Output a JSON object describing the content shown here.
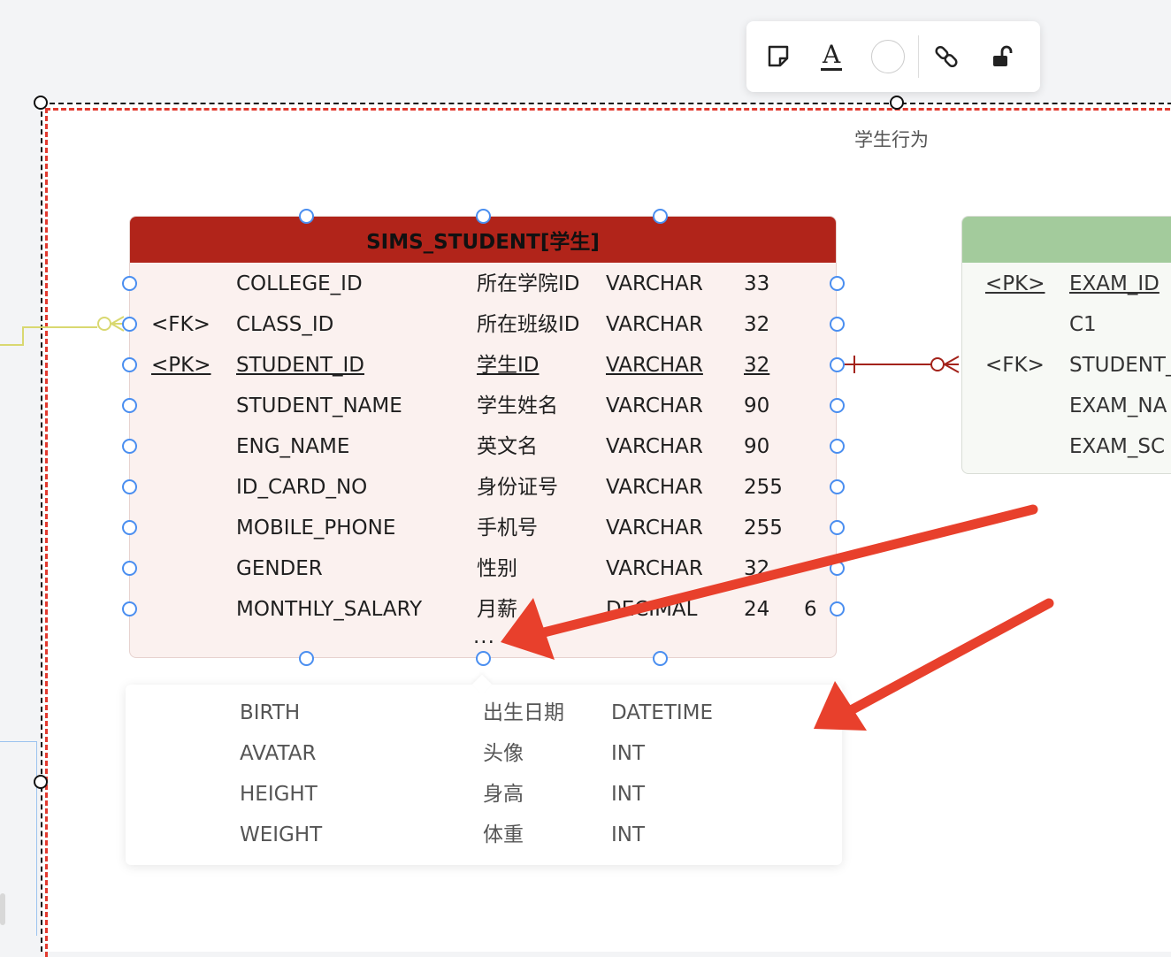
{
  "toolbar": {
    "buttons": [
      "sticky-note-icon",
      "text-color-icon",
      "fill-color-icon",
      "link-icon",
      "unlock-icon"
    ],
    "text_icon_glyph": "A"
  },
  "group": {
    "label": "学生行为"
  },
  "student_table": {
    "title": "SIMS_STUDENT[学生]",
    "header_color": "#b1241a",
    "columns": [
      {
        "key": "",
        "name": "COLLEGE_ID",
        "comment": "所在学院ID",
        "type": "VARCHAR",
        "length": "33",
        "scale": ""
      },
      {
        "key": "<FK>",
        "name": "CLASS_ID",
        "comment": "所在班级ID",
        "type": "VARCHAR",
        "length": "32",
        "scale": ""
      },
      {
        "key": "<PK>",
        "name": "STUDENT_ID",
        "comment": "学生ID",
        "type": "VARCHAR",
        "length": "32",
        "scale": ""
      },
      {
        "key": "",
        "name": "STUDENT_NAME",
        "comment": "学生姓名",
        "type": "VARCHAR",
        "length": "90",
        "scale": ""
      },
      {
        "key": "",
        "name": "ENG_NAME",
        "comment": "英文名",
        "type": "VARCHAR",
        "length": "90",
        "scale": ""
      },
      {
        "key": "",
        "name": "ID_CARD_NO",
        "comment": "身份证号",
        "type": "VARCHAR",
        "length": "255",
        "scale": ""
      },
      {
        "key": "",
        "name": "MOBILE_PHONE",
        "comment": "手机号",
        "type": "VARCHAR",
        "length": "255",
        "scale": ""
      },
      {
        "key": "",
        "name": "GENDER",
        "comment": "性别",
        "type": "VARCHAR",
        "length": "32",
        "scale": ""
      },
      {
        "key": "",
        "name": "MONTHLY_SALARY",
        "comment": "月薪",
        "type": "DECIMAL",
        "length": "24",
        "scale": "6"
      }
    ],
    "more": "..."
  },
  "more_popover": {
    "columns": [
      {
        "name": "BIRTH",
        "comment": "出生日期",
        "type": "DATETIME"
      },
      {
        "name": "AVATAR",
        "comment": "头像",
        "type": "INT"
      },
      {
        "name": "HEIGHT",
        "comment": "身高",
        "type": "INT"
      },
      {
        "name": "WEIGHT",
        "comment": "体重",
        "type": "INT"
      }
    ]
  },
  "exam_table": {
    "header_color": "#a3cb9c",
    "columns": [
      {
        "key": "<PK>",
        "name": "EXAM_ID"
      },
      {
        "key": "",
        "name": "C1"
      },
      {
        "key": "<FK>",
        "name": "STUDENT_"
      },
      {
        "key": "",
        "name": "EXAM_NA"
      },
      {
        "key": "",
        "name": "EXAM_SC"
      }
    ]
  },
  "colors": {
    "annotation_arrow": "#e8402c",
    "selection_red": "#e23a2f",
    "anchor_blue": "#4a8ef0",
    "relation_red": "#a3221a",
    "relation_yellow": "#d9d870"
  }
}
